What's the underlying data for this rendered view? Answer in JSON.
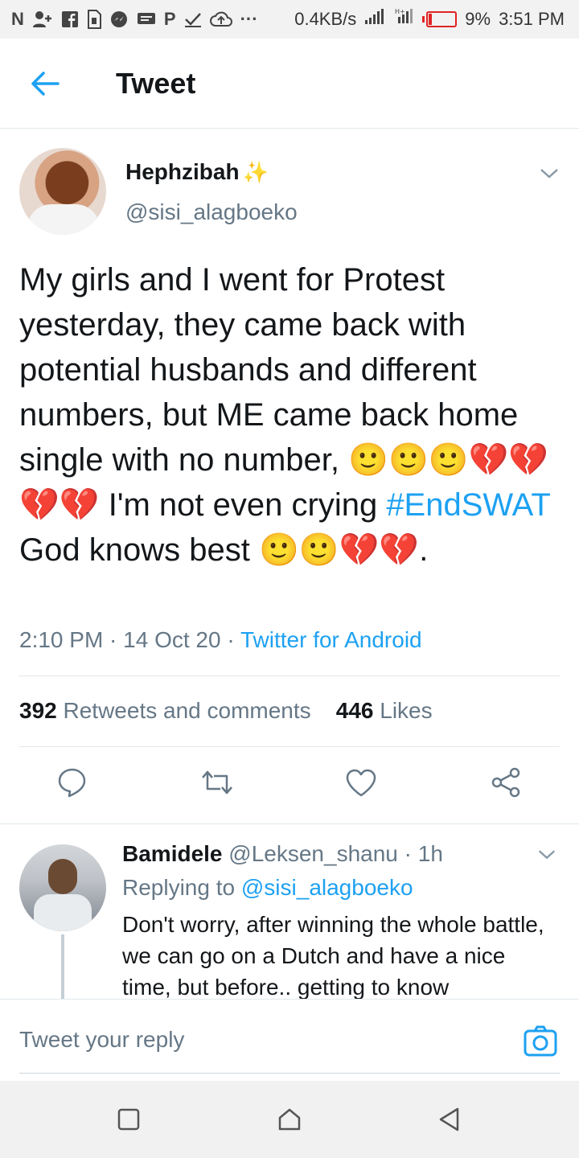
{
  "status_bar": {
    "left_icons": [
      "N",
      "user-plus",
      "facebook",
      "sim-card",
      "messenger",
      "message",
      "P",
      "check",
      "cloud-upload",
      "..."
    ],
    "net_speed": "0.4KB/s",
    "battery": "9%",
    "time": "3:51 PM"
  },
  "header": {
    "title": "Tweet"
  },
  "tweet": {
    "author_name": "Hephzibah",
    "author_handle": "@sisi_alagboeko",
    "text_part1": "My girls and I went for Protest yesterday, they came back with potential husbands and different numbers, but ME came back home single with no number, ",
    "emoji_smile": "🙂",
    "emoji_broken_heart": "💔",
    "text_part2": " I'm not even crying ",
    "hashtag": "#EndSWAT",
    "text_part3": " God knows best ",
    "text_part4": ".",
    "time": "2:10 PM",
    "date": "14 Oct 20",
    "source": "Twitter for Android",
    "separator": " · ",
    "retweets_count": "392",
    "retweets_label": "Retweets and comments",
    "likes_count": "446",
    "likes_label": "Likes"
  },
  "reply": {
    "name": "Bamidele",
    "handle": "@Leksen_shanu",
    "age": "1h",
    "replying_label": "Replying to",
    "replying_to": "@sisi_alagboeko",
    "text": "Don't worry, after winning the whole battle, we can go on a Dutch and have a nice time, but before.. getting to know"
  },
  "reply_bar": {
    "placeholder": "Tweet your reply"
  },
  "colors": {
    "accent": "#1da1f2",
    "muted": "#657786",
    "text": "#14171a",
    "divider": "#e1e8ed"
  }
}
